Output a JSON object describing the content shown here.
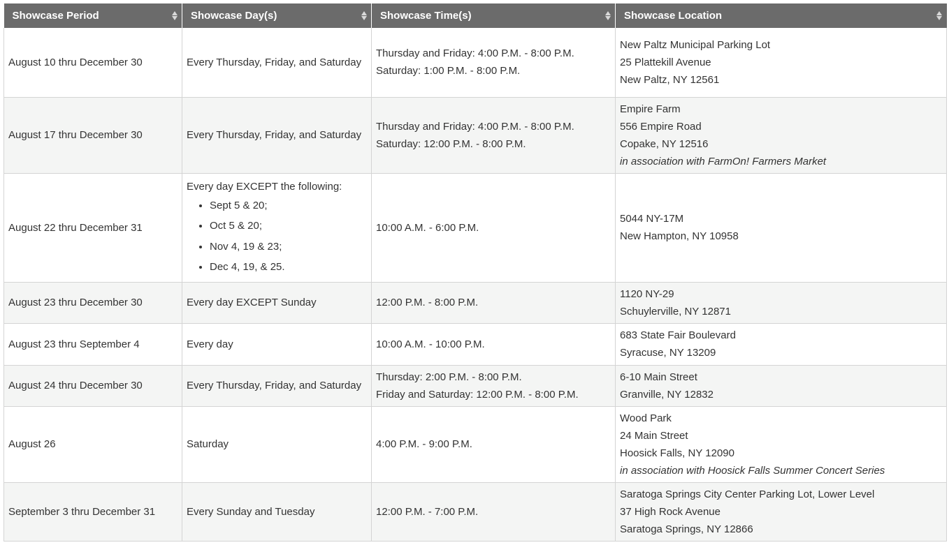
{
  "headers": [
    "Showcase Period",
    "Showcase Day(s)",
    "Showcase Time(s)",
    "Showcase Location"
  ],
  "rows": [
    {
      "period": "August 10 thru December 30",
      "days": "Every Thursday, Friday, and Saturday",
      "times": [
        "Thursday and Friday: 4:00 P.M. - 8:00 P.M.",
        "Saturday: 1:00 P.M. - 8:00 P.M."
      ],
      "location": [
        "New Paltz Municipal Parking Lot",
        "25 Plattekill Avenue",
        "New Paltz, NY 12561"
      ],
      "note": ""
    },
    {
      "period": "August 17 thru December 30",
      "days": "Every Thursday, Friday, and Saturday",
      "times": [
        "Thursday and Friday: 4:00 P.M. - 8:00 P.M.",
        "Saturday: 12:00 P.M. - 8:00 P.M."
      ],
      "location": [
        "Empire Farm",
        "556 Empire Road",
        "Copake, NY 12516"
      ],
      "note": "in association with FarmOn! Farmers Market"
    },
    {
      "period": "August 22 thru December 31",
      "days": "Every day EXCEPT the following:",
      "exceptions": [
        "Sept 5 & 20;",
        "Oct 5 & 20;",
        "Nov 4, 19 & 23;",
        "Dec 4, 19, & 25."
      ],
      "times": [
        "10:00 A.M. - 6:00 P.M."
      ],
      "location": [
        "5044 NY-17M",
        "New Hampton, NY 10958"
      ],
      "note": ""
    },
    {
      "period": "August 23 thru December 30",
      "days": "Every day EXCEPT Sunday",
      "times": [
        "12:00 P.M. - 8:00 P.M."
      ],
      "location": [
        "1120 NY-29",
        "Schuylerville, NY 12871"
      ],
      "note": ""
    },
    {
      "period": "August 23 thru September 4",
      "days": "Every day",
      "times": [
        "10:00 A.M. - 10:00 P.M."
      ],
      "location": [
        "683 State Fair Boulevard",
        "Syracuse, NY 13209"
      ],
      "note": ""
    },
    {
      "period": "August 24 thru December 30",
      "days": "Every Thursday, Friday, and Saturday",
      "times": [
        "Thursday: 2:00 P.M. - 8:00 P.M.",
        "Friday and Saturday: 12:00 P.M. - 8:00 P.M."
      ],
      "location": [
        "6-10 Main Street",
        "Granville, NY 12832"
      ],
      "note": ""
    },
    {
      "period": "August 26",
      "days": "Saturday",
      "times": [
        "4:00 P.M. - 9:00 P.M."
      ],
      "location": [
        "Wood Park",
        "24 Main Street",
        "Hoosick Falls, NY 12090"
      ],
      "note": "in association with Hoosick Falls Summer Concert Series"
    },
    {
      "period": "September 3 thru December 31",
      "days": "Every Sunday and Tuesday",
      "times": [
        "12:00 P.M. - 7:00 P.M."
      ],
      "location": [
        "Saratoga Springs City Center Parking Lot, Lower Level",
        "37 High Rock Avenue",
        "Saratoga Springs, NY 12866"
      ],
      "note": ""
    }
  ],
  "icons": {
    "sort": "sort-arrows-icon"
  },
  "colors": {
    "header_bg": "#6b6b6b",
    "header_text": "#ffffff",
    "stripe_bg": "#f4f5f4",
    "border": "#d4d4d4"
  }
}
